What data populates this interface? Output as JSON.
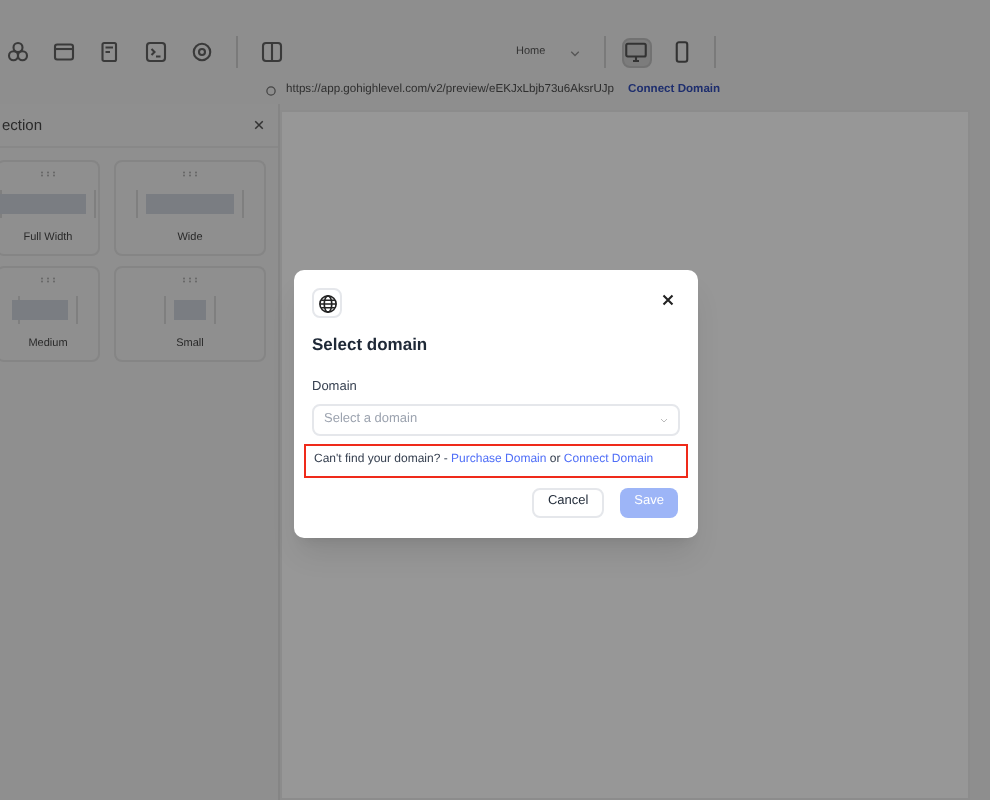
{
  "toolbar": {
    "page_select": {
      "value": "Home"
    },
    "devices": [
      {
        "kind": "desktop",
        "selected": true
      },
      {
        "kind": "mobile",
        "selected": false
      }
    ]
  },
  "url_bar": {
    "url": "https://app.gohighlevel.com/v2/preview/eEKJxLbjb73u6AksrUJp",
    "link": "Connect Domain"
  },
  "side_panel": {
    "title": "ection",
    "options": [
      {
        "label": "Full Width",
        "kind": "full"
      },
      {
        "label": "Wide",
        "kind": "wide"
      },
      {
        "label": "Medium",
        "kind": "medium"
      },
      {
        "label": "Small",
        "kind": "small"
      }
    ]
  },
  "dialog": {
    "title": "Select domain",
    "field_label": "Domain",
    "placeholder": "Select a domain",
    "help_text": "Can't find your domain? -",
    "purchase_link": "Purchase Domain",
    "or_text": "or",
    "connect_link": "Connect Domain",
    "highlighted": true,
    "buttons": [
      {
        "label": "Cancel",
        "kind": "secondary"
      },
      {
        "label": "Save",
        "kind": "primary",
        "disabled": true
      }
    ]
  }
}
